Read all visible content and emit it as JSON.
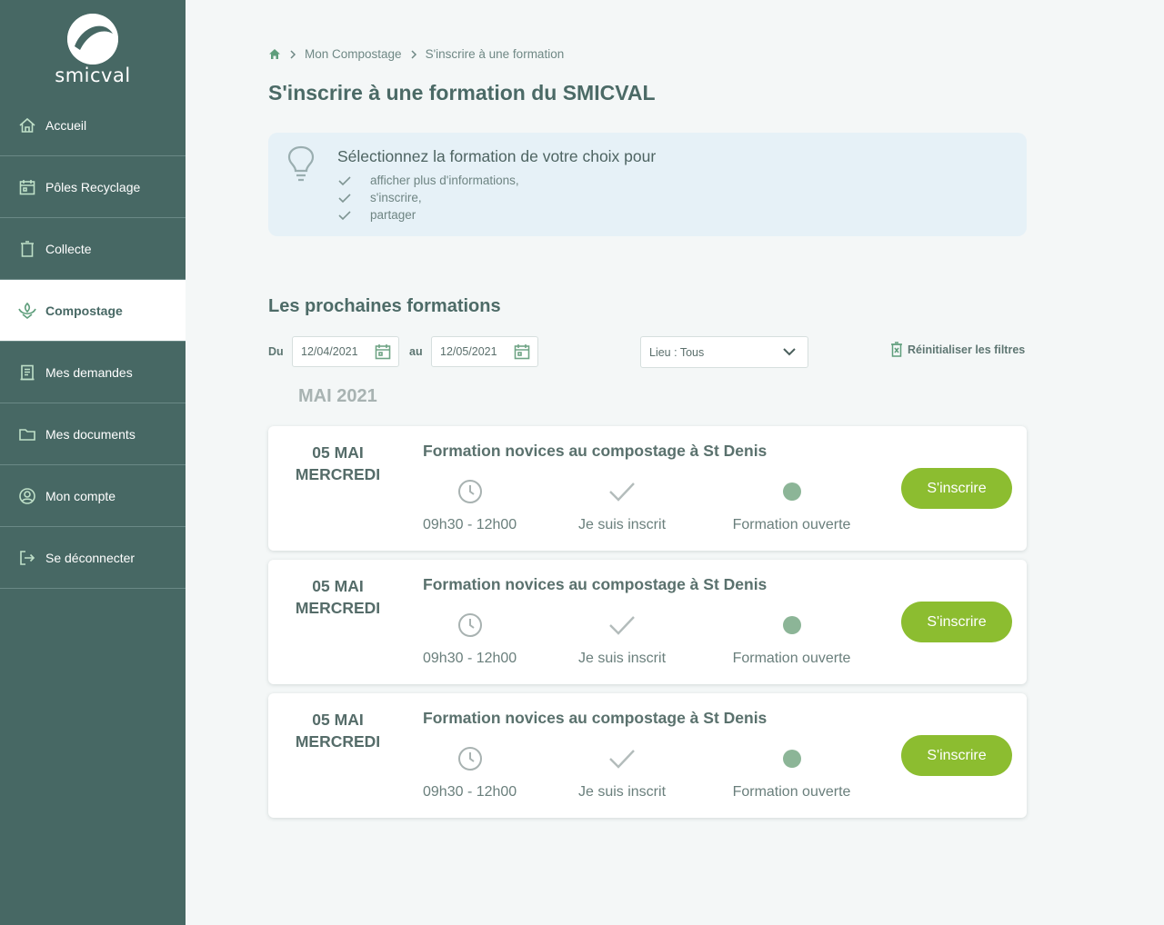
{
  "brand": {
    "name": "smicval",
    "color": "#476864",
    "accent": "#8cbd30"
  },
  "sidebar": {
    "items": [
      {
        "label": "Accueil",
        "icon": "home-icon"
      },
      {
        "label": "Pôles Recyclage",
        "icon": "calendar-icon"
      },
      {
        "label": "Collecte",
        "icon": "trash-icon"
      },
      {
        "label": "Compostage",
        "icon": "sprout-icon",
        "active": true
      },
      {
        "label": "Mes demandes",
        "icon": "document-list-icon"
      },
      {
        "label": "Mes documents",
        "icon": "folder-icon"
      },
      {
        "label": "Mon compte",
        "icon": "user-circle-icon"
      },
      {
        "label": "Se déconnecter",
        "icon": "logout-icon"
      }
    ]
  },
  "breadcrumb": {
    "home_icon": "home-icon",
    "level1": "Mon Compostage",
    "level2": "S'inscrire à une formation"
  },
  "page": {
    "title": "S'inscrire à une formation du SMICVAL"
  },
  "info": {
    "title": "Sélectionnez la formation de votre choix pour",
    "items": [
      "afficher plus d'informations,",
      "s'inscrire,",
      "partager"
    ]
  },
  "section": {
    "title": "Les prochaines formations"
  },
  "filters": {
    "from_label": "Du",
    "from_value": "12/04/2021",
    "to_label": "au",
    "to_value": "12/05/2021",
    "place_select": "Lieu : Tous",
    "reset_label": "Réinitialiser les filtres"
  },
  "month": "MAI 2021",
  "formations": [
    {
      "day": "05 MAI",
      "weekday": "MERCREDI",
      "title": "Formation novices au compostage à St Denis",
      "time": "09h30 - 12h00",
      "registered": "Je suis inscrit",
      "status": "Formation ouverte",
      "button": "S'inscrire"
    },
    {
      "day": "05 MAI",
      "weekday": "MERCREDI",
      "title": "Formation novices au compostage à St Denis",
      "time": "09h30 - 12h00",
      "registered": "Je suis inscrit",
      "status": "Formation ouverte",
      "button": "S'inscrire"
    },
    {
      "day": "05 MAI",
      "weekday": "MERCREDI",
      "title": "Formation novices au compostage à St Denis",
      "time": "09h30 - 12h00",
      "registered": "Je suis inscrit",
      "status": "Formation ouverte",
      "button": "S'inscrire"
    }
  ]
}
